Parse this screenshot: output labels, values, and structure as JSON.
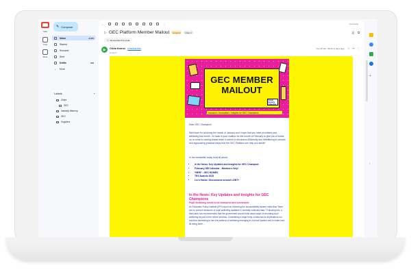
{
  "rail": {
    "mail_label": "Mail",
    "chat_label": "Chat",
    "meet_label": "Meet"
  },
  "sidebar": {
    "compose_label": "Compose",
    "items": [
      {
        "label": "Inbox",
        "count": "3,070",
        "active": true
      },
      {
        "label": "Starred",
        "count": ""
      },
      {
        "label": "Snoozed",
        "count": ""
      },
      {
        "label": "Sent",
        "count": ""
      },
      {
        "label": "Drafts",
        "count": "100"
      },
      {
        "label": "More",
        "count": ""
      }
    ],
    "labels_heading": "Labels",
    "labels_add": "+",
    "labels": [
      "Client",
      "GEC",
      "Instantly Warmup",
      "SEO",
      "Suppliers"
    ]
  },
  "toolbar": {
    "pager": "3 of many"
  },
  "email": {
    "subject": "GEC Platform Member Mailout",
    "badge_external": "External",
    "badge_inbox": "Inbox ×",
    "summarize_label": "Summarise this email",
    "avatar_letter": "▶",
    "sender_name": "Olivia Kearns",
    "unsubscribe": "Unsubscribe",
    "to_me": "to me ▾",
    "timestamp": "Tue 28 Jan, 09:00 (4 days ago)"
  },
  "banner": {
    "title_line1": "GEC MEMBER",
    "title_line2": "MAILOUT",
    "tagline": "Inclusion • Innovation • Insights for GEC Champions",
    "logo_text": "Global Equality Collective"
  },
  "body": {
    "greeting": "Dear GEC Champion!",
    "intro": "Well done for surviving the month of January and I hope that you have prioritised your wellbeing this month. I'm back in your mailbox for the month of February to give you a heads up on what is coming ahead when it comes to #inclusion #Diversity and #Wellbeing in schools and signposting practical steps that the GEC Platform can help you tackle!",
    "newsletter_lead": "In the newsletter today read all about:",
    "bullets": [
      "In the News: Key Updates and Insights for GEC Champion",
      "February DEI Calendar - Members Only!",
      "*NEW* - GEC HOMES",
      "TES Awards 2025",
      "Liv's Hacks: Discussions around LGBT+"
    ],
    "news_heading": "In the News: Key Updates and Insights for GEC Champions",
    "pupil_heading": "Pupil wellbeing needs to be measured and scrutinised",
    "pupil_body": "An Education Policy Institute (EPI) report on reforming the accountability system notes that \"there are no current measures of pupil wellbeing available in centrally collected data.\" Following this, a think tank has recommended that the government should think about ways of recording pupil wellbeing as part of the reform process. Considering a large body of data has its implications too, could be interesting to see the patterns of wellbeing emerging in a school system and to make sure its being done…"
  }
}
